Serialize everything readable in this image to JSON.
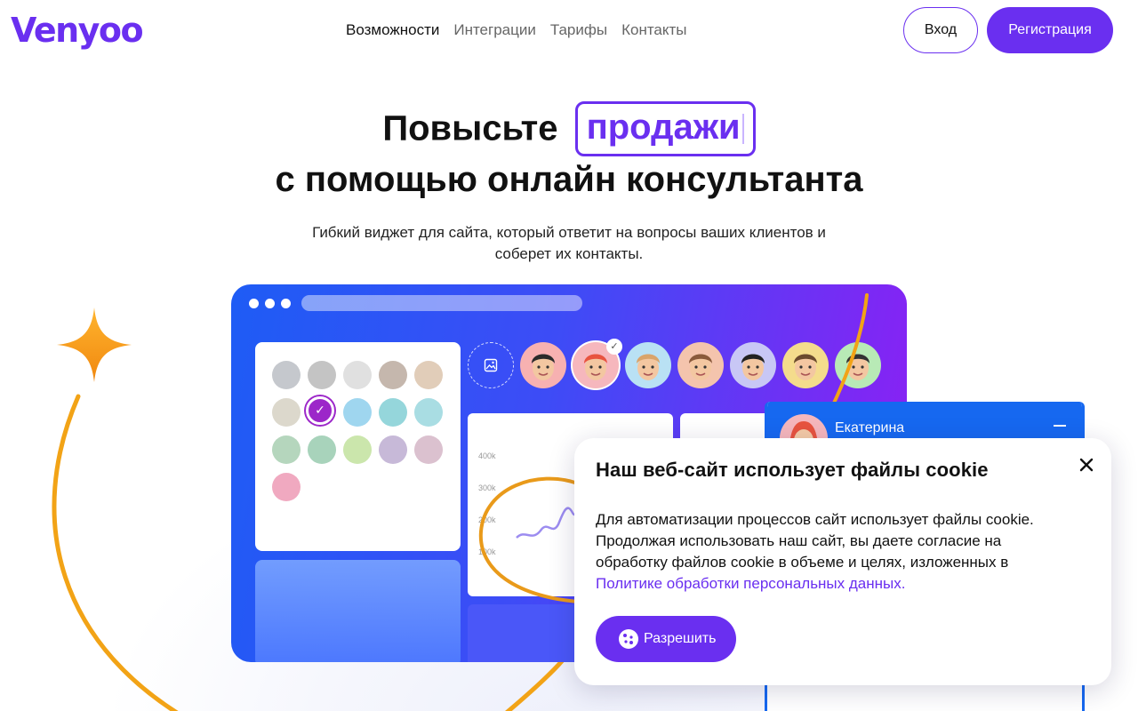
{
  "brand": {
    "logo_text": "Venyoo",
    "accent": "#6a2ff0"
  },
  "nav": {
    "items": [
      {
        "label": "Возможности",
        "active": true
      },
      {
        "label": "Интеграции",
        "active": false
      },
      {
        "label": "Тарифы",
        "active": false
      },
      {
        "label": "Контакты",
        "active": false
      }
    ],
    "login_label": "Вход",
    "signup_label": "Регистрация"
  },
  "hero": {
    "title_prefix": "Повысьте",
    "title_highlight": "продажи",
    "title_line2": "с помощью онлайн консультанта",
    "subtitle": "Гибкий виджет для сайта, который ответит на вопросы ваших клиентов и соберет их контакты."
  },
  "mockup": {
    "palette_colors": [
      "#c5c8cd",
      "#c4c4c4",
      "#e0e0e0",
      "#c5b7ad",
      "#e1cdb9",
      "#dcd8cc",
      "#9c27c9",
      "#9fd6ef",
      "#95d6db",
      "#a9dde3",
      "#b5d6bd",
      "#a8d3bb",
      "#cbe6ac",
      "#c7b9d8",
      "#dbc1cf",
      "#f0a9c0"
    ],
    "selected_color_index": 6,
    "chart_ticks": [
      "400k",
      "300k",
      "200k",
      "100k"
    ],
    "avatar_colors": [
      "#f7b1b1",
      "#f6b7bd",
      "#b9e1f4",
      "#f4c4ad",
      "#c8c7f5",
      "#f4dc8c",
      "#b8eab6"
    ]
  },
  "chat": {
    "agent_name": "Екатерина"
  },
  "cookie": {
    "title": "Наш веб-сайт использует файлы cookie",
    "body": "Для автоматизации процессов сайт использует файлы cookie. Продолжая использовать наш сайт, вы даете согласие на обработку файлов cookie в объеме и целях, изложенных в",
    "link_text": "Политике обработки персональных данных.",
    "allow_label": "Разрешить"
  }
}
